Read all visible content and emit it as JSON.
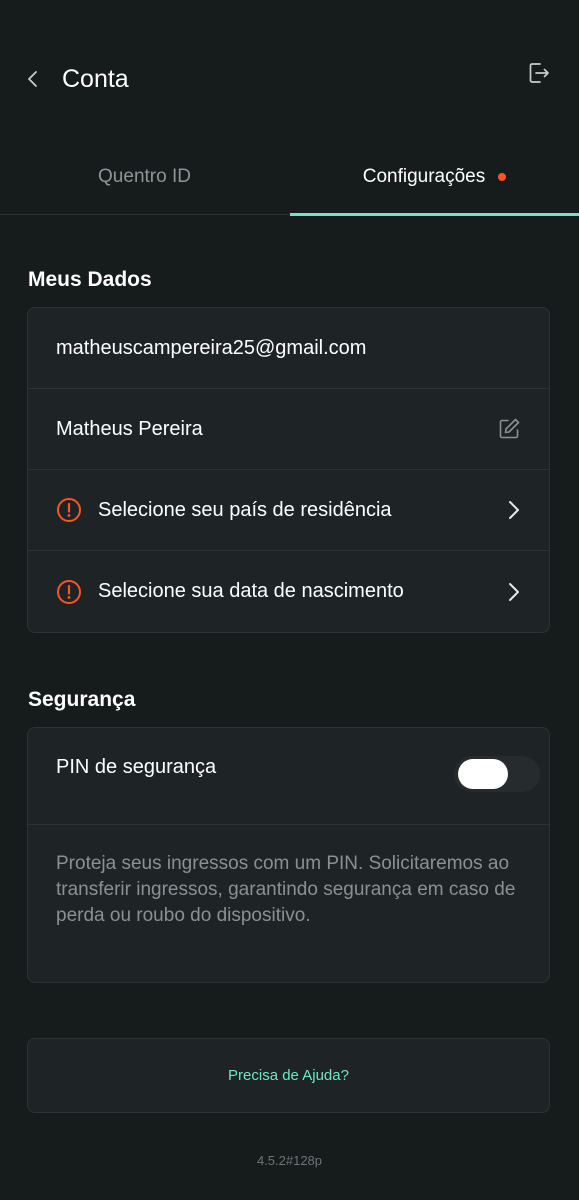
{
  "header": {
    "title": "Conta",
    "back_icon": "chevron-left-icon",
    "logout_icon": "logout-icon"
  },
  "tabs": [
    {
      "label": "Quentro ID",
      "active": false
    },
    {
      "label": "Configurações",
      "active": true,
      "has_badge": true
    }
  ],
  "colors": {
    "accent": "#70e6c2",
    "badge": "#ff5225",
    "warning": "#ff5225",
    "background": "#161b1c",
    "card": "#1e2426"
  },
  "meus_dados": {
    "title": "Meus Dados",
    "email": "matheuscampereira25@gmail.com",
    "name": "Matheus Pereira",
    "country_label": "Selecione seu país de residência",
    "birthdate_label": "Selecione sua data de nascimento"
  },
  "seguranca": {
    "title": "Segurança",
    "pin_label": "PIN de segurança",
    "pin_enabled": false,
    "pin_description": "Proteja seus ingressos com um PIN. Solicitaremos ao transferir ingressos, garantindo segurança em caso de perda ou roubo do dispositivo."
  },
  "help": {
    "label": "Precisa de Ajuda?"
  },
  "version": "4.5.2#128p"
}
